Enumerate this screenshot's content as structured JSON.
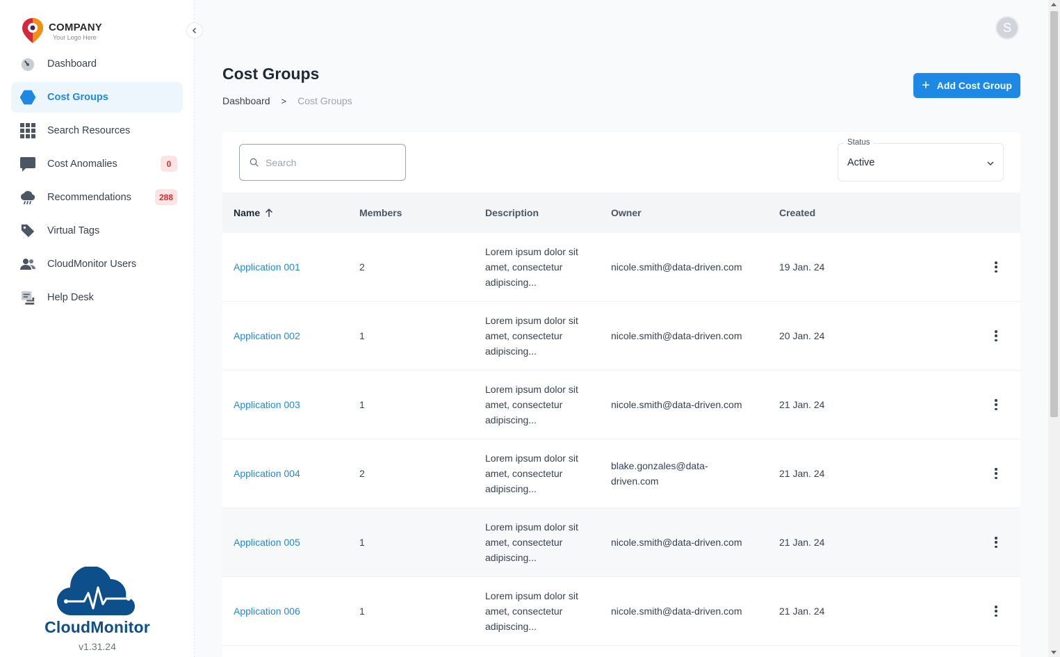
{
  "logo": {
    "company": "COMPANY",
    "tagline": "Your Logo Here"
  },
  "sidebar": {
    "items": [
      {
        "label": "Dashboard",
        "icon": "gauge-icon",
        "active": false
      },
      {
        "label": "Cost Groups",
        "icon": "hexagon-icon",
        "active": true
      },
      {
        "label": "Search Resources",
        "icon": "grid-icon",
        "active": false
      },
      {
        "label": "Cost Anomalies",
        "icon": "chat-bubble-icon",
        "active": false,
        "badge": "0"
      },
      {
        "label": "Recommendations",
        "icon": "cloud-rain-icon",
        "active": false,
        "badge": "288"
      },
      {
        "label": "Virtual Tags",
        "icon": "tag-icon",
        "active": false
      },
      {
        "label": "CloudMonitor Users",
        "icon": "users-icon",
        "active": false
      },
      {
        "label": "Help Desk",
        "icon": "helpdesk-icon",
        "active": false
      }
    ]
  },
  "brand": {
    "name": "CloudMonitor",
    "version": "v1.31.24"
  },
  "header": {
    "avatar_initial": "S"
  },
  "page": {
    "title": "Cost Groups",
    "breadcrumb": {
      "home": "Dashboard",
      "separator": ">",
      "current": "Cost Groups"
    },
    "add_button": "Add Cost Group"
  },
  "filters": {
    "search_placeholder": "Search",
    "status_label": "Status",
    "status_value": "Active"
  },
  "table": {
    "columns": {
      "name": "Name",
      "members": "Members",
      "description": "Description",
      "owner": "Owner",
      "created": "Created"
    },
    "rows": [
      {
        "name": "Application 001",
        "members": "2",
        "description": "Lorem ipsum dolor sit amet, consectetur adipiscing...",
        "owner": "nicole.smith@data-driven.com",
        "created": "19 Jan. 24"
      },
      {
        "name": "Application 002",
        "members": "1",
        "description": "Lorem ipsum dolor sit amet, consectetur adipiscing...",
        "owner": "nicole.smith@data-driven.com",
        "created": "20 Jan. 24"
      },
      {
        "name": "Application 003",
        "members": "1",
        "description": "Lorem ipsum dolor sit amet, consectetur adipiscing...",
        "owner": "nicole.smith@data-driven.com",
        "created": "21 Jan. 24"
      },
      {
        "name": "Application 004",
        "members": "2",
        "description": "Lorem ipsum dolor sit amet, consectetur adipiscing...",
        "owner": "blake.gonzales@data-driven.com",
        "created": "21 Jan. 24"
      },
      {
        "name": "Application 005",
        "members": "1",
        "description": "Lorem ipsum dolor sit amet, consectetur adipiscing...",
        "owner": "nicole.smith@data-driven.com",
        "created": "21 Jan. 24"
      },
      {
        "name": "Application 006",
        "members": "1",
        "description": "Lorem ipsum dolor sit amet, consectetur adipiscing...",
        "owner": "nicole.smith@data-driven.com",
        "created": "21 Jan. 24"
      }
    ]
  },
  "colors": {
    "accent": "#1e88e5",
    "brand_dark": "#0d4f8b",
    "badge_bg": "#fde4e4",
    "badge_text": "#d32f2f"
  }
}
